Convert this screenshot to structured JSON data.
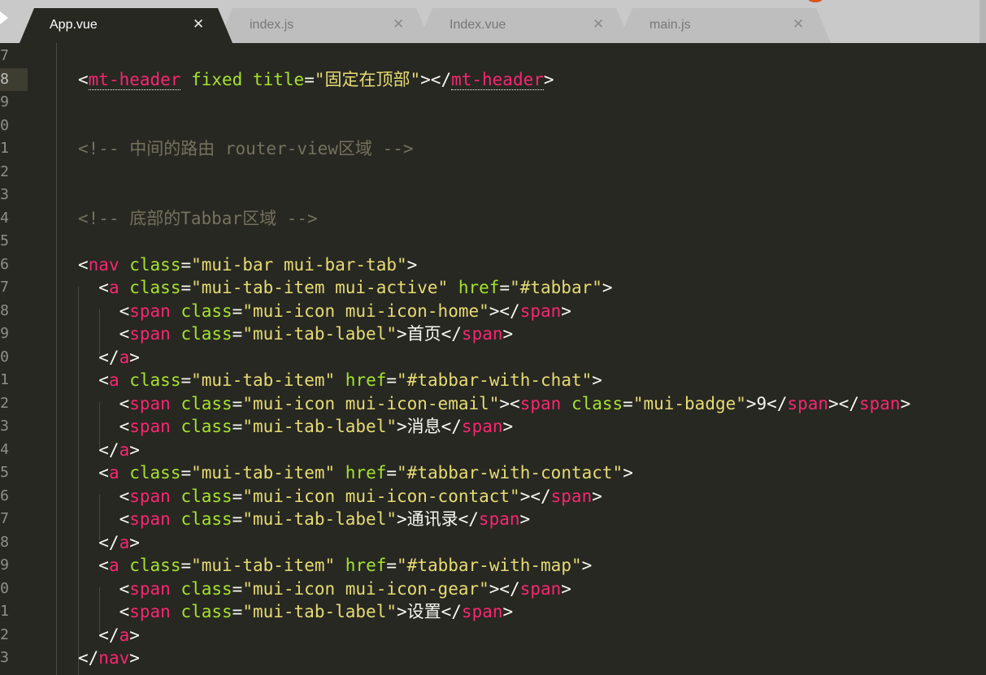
{
  "tabs": [
    {
      "label": "App.vue",
      "active": true
    },
    {
      "label": "index.js",
      "active": false
    },
    {
      "label": "Index.vue",
      "active": false
    },
    {
      "label": "main.js",
      "active": false
    }
  ],
  "close_glyph": "✕",
  "gutter": {
    "line_numbers": [
      "7",
      "8",
      "9",
      "0",
      "1",
      "2",
      "3",
      "4",
      "5",
      "6",
      "7",
      "8",
      "9",
      "0",
      "1",
      "2",
      "3",
      "4",
      "5",
      "6",
      "7",
      "8",
      "9",
      "0",
      "1",
      "2",
      "3"
    ],
    "current_line_index": 1
  },
  "code_lines": [
    {
      "tokens": []
    },
    {
      "tokens": [
        {
          "c": "p",
          "t": "<"
        },
        {
          "c": "t u",
          "t": "mt-header"
        },
        {
          "c": "p",
          "t": " "
        },
        {
          "c": "a",
          "t": "fixed"
        },
        {
          "c": "p",
          "t": " "
        },
        {
          "c": "a",
          "t": "title"
        },
        {
          "c": "p",
          "t": "="
        },
        {
          "c": "s",
          "t": "\"固定在顶部\""
        },
        {
          "c": "p",
          "t": "></"
        },
        {
          "c": "t u",
          "t": "mt-header"
        },
        {
          "c": "p",
          "t": ">"
        }
      ]
    },
    {
      "tokens": []
    },
    {
      "tokens": []
    },
    {
      "tokens": [
        {
          "c": "c",
          "t": "<!-- 中间的路由 router-view区域 -->"
        }
      ]
    },
    {
      "tokens": []
    },
    {
      "tokens": []
    },
    {
      "tokens": [
        {
          "c": "c",
          "t": "<!-- 底部的Tabbar区域 -->"
        }
      ]
    },
    {
      "tokens": []
    },
    {
      "tokens": [
        {
          "c": "p",
          "t": "<"
        },
        {
          "c": "t",
          "t": "nav"
        },
        {
          "c": "p",
          "t": " "
        },
        {
          "c": "a",
          "t": "class"
        },
        {
          "c": "p",
          "t": "="
        },
        {
          "c": "s",
          "t": "\"mui-bar mui-bar-tab\""
        },
        {
          "c": "p",
          "t": ">"
        }
      ]
    },
    {
      "tokens": [
        {
          "c": "p",
          "t": "  <"
        },
        {
          "c": "t",
          "t": "a"
        },
        {
          "c": "p",
          "t": " "
        },
        {
          "c": "a",
          "t": "class"
        },
        {
          "c": "p",
          "t": "="
        },
        {
          "c": "s",
          "t": "\"mui-tab-item mui-active\""
        },
        {
          "c": "p",
          "t": " "
        },
        {
          "c": "a",
          "t": "href"
        },
        {
          "c": "p",
          "t": "="
        },
        {
          "c": "s",
          "t": "\"#tabbar\""
        },
        {
          "c": "p",
          "t": ">"
        }
      ]
    },
    {
      "tokens": [
        {
          "c": "p",
          "t": "    <"
        },
        {
          "c": "t",
          "t": "span"
        },
        {
          "c": "p",
          "t": " "
        },
        {
          "c": "a",
          "t": "class"
        },
        {
          "c": "p",
          "t": "="
        },
        {
          "c": "s",
          "t": "\"mui-icon mui-icon-home\""
        },
        {
          "c": "p",
          "t": "></"
        },
        {
          "c": "t",
          "t": "span"
        },
        {
          "c": "p",
          "t": ">"
        }
      ]
    },
    {
      "tokens": [
        {
          "c": "p",
          "t": "    <"
        },
        {
          "c": "t",
          "t": "span"
        },
        {
          "c": "p",
          "t": " "
        },
        {
          "c": "a",
          "t": "class"
        },
        {
          "c": "p",
          "t": "="
        },
        {
          "c": "s",
          "t": "\"mui-tab-label\""
        },
        {
          "c": "p",
          "t": ">首页</"
        },
        {
          "c": "t",
          "t": "span"
        },
        {
          "c": "p",
          "t": ">"
        }
      ]
    },
    {
      "tokens": [
        {
          "c": "p",
          "t": "  </"
        },
        {
          "c": "t",
          "t": "a"
        },
        {
          "c": "p",
          "t": ">"
        }
      ]
    },
    {
      "tokens": [
        {
          "c": "p",
          "t": "  <"
        },
        {
          "c": "t",
          "t": "a"
        },
        {
          "c": "p",
          "t": " "
        },
        {
          "c": "a",
          "t": "class"
        },
        {
          "c": "p",
          "t": "="
        },
        {
          "c": "s",
          "t": "\"mui-tab-item\""
        },
        {
          "c": "p",
          "t": " "
        },
        {
          "c": "a",
          "t": "href"
        },
        {
          "c": "p",
          "t": "="
        },
        {
          "c": "s",
          "t": "\"#tabbar-with-chat\""
        },
        {
          "c": "p",
          "t": ">"
        }
      ]
    },
    {
      "tokens": [
        {
          "c": "p",
          "t": "    <"
        },
        {
          "c": "t",
          "t": "span"
        },
        {
          "c": "p",
          "t": " "
        },
        {
          "c": "a",
          "t": "class"
        },
        {
          "c": "p",
          "t": "="
        },
        {
          "c": "s",
          "t": "\"mui-icon mui-icon-email\""
        },
        {
          "c": "p",
          "t": "><"
        },
        {
          "c": "t",
          "t": "span"
        },
        {
          "c": "p",
          "t": " "
        },
        {
          "c": "a",
          "t": "class"
        },
        {
          "c": "p",
          "t": "="
        },
        {
          "c": "s",
          "t": "\"mui-badge\""
        },
        {
          "c": "p",
          "t": ">9</"
        },
        {
          "c": "t",
          "t": "span"
        },
        {
          "c": "p",
          "t": "></"
        },
        {
          "c": "t",
          "t": "span"
        },
        {
          "c": "p",
          "t": ">"
        }
      ]
    },
    {
      "tokens": [
        {
          "c": "p",
          "t": "    <"
        },
        {
          "c": "t",
          "t": "span"
        },
        {
          "c": "p",
          "t": " "
        },
        {
          "c": "a",
          "t": "class"
        },
        {
          "c": "p",
          "t": "="
        },
        {
          "c": "s",
          "t": "\"mui-tab-label\""
        },
        {
          "c": "p",
          "t": ">消息</"
        },
        {
          "c": "t",
          "t": "span"
        },
        {
          "c": "p",
          "t": ">"
        }
      ]
    },
    {
      "tokens": [
        {
          "c": "p",
          "t": "  </"
        },
        {
          "c": "t",
          "t": "a"
        },
        {
          "c": "p",
          "t": ">"
        }
      ]
    },
    {
      "tokens": [
        {
          "c": "p",
          "t": "  <"
        },
        {
          "c": "t",
          "t": "a"
        },
        {
          "c": "p",
          "t": " "
        },
        {
          "c": "a",
          "t": "class"
        },
        {
          "c": "p",
          "t": "="
        },
        {
          "c": "s",
          "t": "\"mui-tab-item\""
        },
        {
          "c": "p",
          "t": " "
        },
        {
          "c": "a",
          "t": "href"
        },
        {
          "c": "p",
          "t": "="
        },
        {
          "c": "s",
          "t": "\"#tabbar-with-contact\""
        },
        {
          "c": "p",
          "t": ">"
        }
      ]
    },
    {
      "tokens": [
        {
          "c": "p",
          "t": "    <"
        },
        {
          "c": "t",
          "t": "span"
        },
        {
          "c": "p",
          "t": " "
        },
        {
          "c": "a",
          "t": "class"
        },
        {
          "c": "p",
          "t": "="
        },
        {
          "c": "s",
          "t": "\"mui-icon mui-icon-contact\""
        },
        {
          "c": "p",
          "t": "></"
        },
        {
          "c": "t",
          "t": "span"
        },
        {
          "c": "p",
          "t": ">"
        }
      ]
    },
    {
      "tokens": [
        {
          "c": "p",
          "t": "    <"
        },
        {
          "c": "t",
          "t": "span"
        },
        {
          "c": "p",
          "t": " "
        },
        {
          "c": "a",
          "t": "class"
        },
        {
          "c": "p",
          "t": "="
        },
        {
          "c": "s",
          "t": "\"mui-tab-label\""
        },
        {
          "c": "p",
          "t": ">通讯录</"
        },
        {
          "c": "t",
          "t": "span"
        },
        {
          "c": "p",
          "t": ">"
        }
      ]
    },
    {
      "tokens": [
        {
          "c": "p",
          "t": "  </"
        },
        {
          "c": "t",
          "t": "a"
        },
        {
          "c": "p",
          "t": ">"
        }
      ]
    },
    {
      "tokens": [
        {
          "c": "p",
          "t": "  <"
        },
        {
          "c": "t",
          "t": "a"
        },
        {
          "c": "p",
          "t": " "
        },
        {
          "c": "a",
          "t": "class"
        },
        {
          "c": "p",
          "t": "="
        },
        {
          "c": "s",
          "t": "\"mui-tab-item\""
        },
        {
          "c": "p",
          "t": " "
        },
        {
          "c": "a",
          "t": "href"
        },
        {
          "c": "p",
          "t": "="
        },
        {
          "c": "s",
          "t": "\"#tabbar-with-map\""
        },
        {
          "c": "p",
          "t": ">"
        }
      ]
    },
    {
      "tokens": [
        {
          "c": "p",
          "t": "    <"
        },
        {
          "c": "t",
          "t": "span"
        },
        {
          "c": "p",
          "t": " "
        },
        {
          "c": "a",
          "t": "class"
        },
        {
          "c": "p",
          "t": "="
        },
        {
          "c": "s",
          "t": "\"mui-icon mui-icon-gear\""
        },
        {
          "c": "p",
          "t": "></"
        },
        {
          "c": "t",
          "t": "span"
        },
        {
          "c": "p",
          "t": ">"
        }
      ]
    },
    {
      "tokens": [
        {
          "c": "p",
          "t": "    <"
        },
        {
          "c": "t",
          "t": "span"
        },
        {
          "c": "p",
          "t": " "
        },
        {
          "c": "a",
          "t": "class"
        },
        {
          "c": "p",
          "t": "="
        },
        {
          "c": "s",
          "t": "\"mui-tab-label\""
        },
        {
          "c": "p",
          "t": ">设置</"
        },
        {
          "c": "t",
          "t": "span"
        },
        {
          "c": "p",
          "t": ">"
        }
      ]
    },
    {
      "tokens": [
        {
          "c": "p",
          "t": "  </"
        },
        {
          "c": "t",
          "t": "a"
        },
        {
          "c": "p",
          "t": ">"
        }
      ]
    },
    {
      "tokens": [
        {
          "c": "p",
          "t": "</"
        },
        {
          "c": "t",
          "t": "nav"
        },
        {
          "c": "p",
          "t": ">"
        }
      ]
    }
  ],
  "colors": {
    "background": "#272822",
    "tag": "#f92672",
    "attribute": "#a6e22e",
    "string": "#e6db74",
    "comment": "#75715e",
    "text": "#f8f8f2"
  }
}
